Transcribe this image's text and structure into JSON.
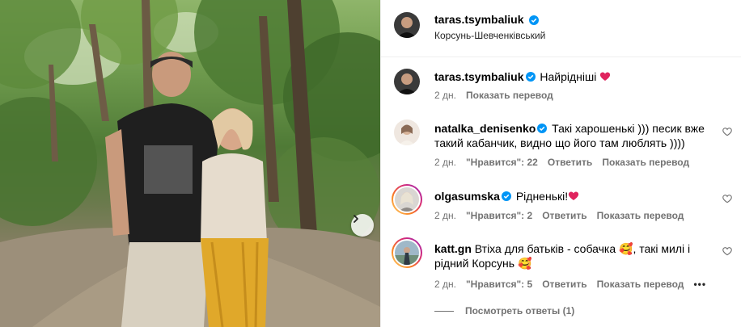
{
  "post": {
    "username": "taras.tsymbaliuk",
    "location": "Корсунь-Шевченківський"
  },
  "comments": [
    {
      "username": "taras.tsymbaliuk",
      "verified": true,
      "text": "Найрідніші",
      "emoji": "❤️",
      "time": "2 дн.",
      "likes": "",
      "reply_label": "",
      "translate_label": "Показать перевод"
    },
    {
      "username": "natalka_denisenko",
      "verified": true,
      "text": "Такі харошенькі ))) песик вже такий кабанчик, видно що його там люблять ))))",
      "time": "2 дн.",
      "likes": "\"Нравится\": 22",
      "reply_label": "Ответить",
      "translate_label": "Показать перевод"
    },
    {
      "username": "olgasumska",
      "verified": true,
      "text": "Рідненькі!",
      "emoji": "❤️",
      "time": "2 дн.",
      "likes": "\"Нравится\": 2",
      "reply_label": "Ответить",
      "translate_label": "Показать перевод"
    },
    {
      "username": "katt.gn",
      "verified": false,
      "text_part1": "Втіха для батьків - собачка",
      "emoji1": "🥰",
      "text_part2": ", такі милі і рідний Корсунь",
      "emoji2": "🥰",
      "time": "2 дн.",
      "likes": "\"Нравится\": 5",
      "reply_label": "Ответить",
      "translate_label": "Показать перевод",
      "more_label": "•••"
    }
  ],
  "view_replies_label": "Посмотреть ответы (1)",
  "colors": {
    "verified": "#0095f6",
    "heart": "#ed4956",
    "meta_text": "#737373",
    "story_ring": "#d300c5"
  },
  "icons": {
    "verified": "verified-badge-icon",
    "like": "heart-outline-icon",
    "next": "chevron-right-icon",
    "more": "more-horizontal-icon"
  }
}
